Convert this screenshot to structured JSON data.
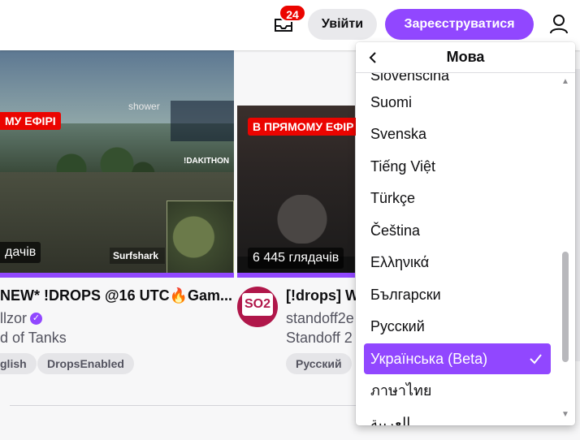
{
  "header": {
    "inbox_count": "24",
    "login_label": "Увійти",
    "signup_label": "Зареєструватися"
  },
  "cards": [
    {
      "live_badge": "В ПРЯМОМУ ЕФІРІ",
      "live_visible": "МУ ЕФІРІ",
      "viewers": "дачів",
      "title": "NEW* !DROPS @16 UTC🔥Gam...",
      "channel": "llzor",
      "game": "d of Tanks",
      "tags": [
        "glish",
        "DropsEnabled"
      ],
      "thumb_overlay_text": "shower",
      "thumb_hud_text": "!DAKITHON",
      "thumb_sponsor": "Surfshark"
    },
    {
      "live_badge": "В ПРЯМОМУ ЕФІР",
      "viewers": "6 445 глядачів",
      "title": "[!drops] W",
      "channel": "standoff2e",
      "game": "Standoff 2",
      "tags": [
        "Русский"
      ],
      "avatar_text": "SO2"
    }
  ],
  "language_menu": {
    "title": "Мова",
    "items": [
      {
        "label": "Slovenščina",
        "selected": false
      },
      {
        "label": "Suomi",
        "selected": false
      },
      {
        "label": "Svenska",
        "selected": false
      },
      {
        "label": "Tiếng Việt",
        "selected": false
      },
      {
        "label": "Türkçe",
        "selected": false
      },
      {
        "label": "Čeština",
        "selected": false
      },
      {
        "label": "Ελληνικά",
        "selected": false
      },
      {
        "label": "Български",
        "selected": false
      },
      {
        "label": "Русский",
        "selected": false
      },
      {
        "label": "Українська (Beta)",
        "selected": true
      },
      {
        "label": "ภาษาไทย",
        "selected": false
      },
      {
        "label": "العربية",
        "selected": false
      }
    ]
  },
  "colors": {
    "brand": "#9147ff",
    "live": "#eb0400"
  },
  "icons": {
    "inbox": "inbox-icon",
    "user": "user-icon",
    "back": "chevron-left-icon",
    "check": "check-icon",
    "verified": "verified-icon"
  }
}
